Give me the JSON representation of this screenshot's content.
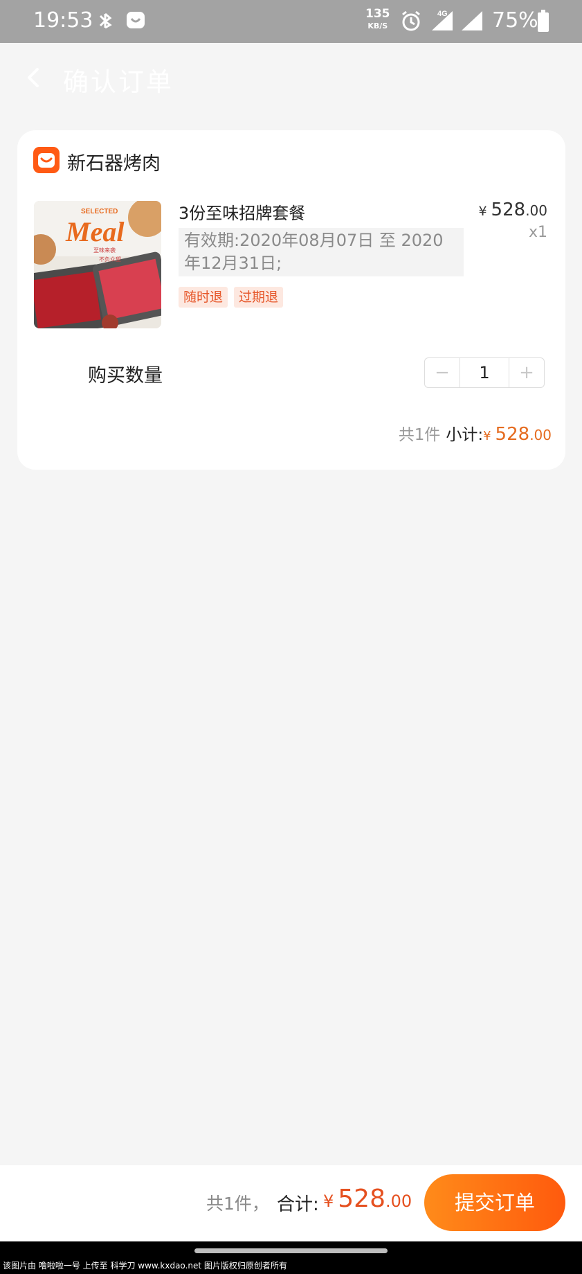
{
  "status_bar": {
    "time": "19:53",
    "net_speed_value": "135",
    "net_speed_unit": "KB/S",
    "network": "4G",
    "battery": "75%"
  },
  "header": {
    "title": "确认订单",
    "back_icon": "chevron-left-icon"
  },
  "shop": {
    "name": "新石器烤肉",
    "logo_icon": "shop-smile-icon",
    "logo_color": "#ff5a14"
  },
  "product": {
    "image_text": "SELECTED",
    "image_brand": "Meal",
    "image_sub1": "至味来袭",
    "image_sub2": "不负众望",
    "title": "3份至味招牌套餐",
    "validity": "有效期:2020年08月07日 至 2020年12月31日;",
    "tags": [
      "随时退",
      "过期退"
    ],
    "price_symbol": "¥",
    "price_int": "528",
    "price_dec": ".00",
    "qty_text": "x1"
  },
  "quantity": {
    "label": "购买数量",
    "value": "1",
    "minus": "−",
    "plus": "+"
  },
  "subtotal": {
    "count_text": "共1件",
    "label": "小计:",
    "symbol": "¥",
    "int": "528",
    "dec": ".00"
  },
  "bottom_bar": {
    "count_text": "共1件，",
    "label": "合计:",
    "symbol": "¥",
    "int": "528",
    "dec": ".00",
    "submit_label": "提交订单",
    "accent_color": "#ff5a0d"
  },
  "watermark": "该图片由 噜啦啦一号 上传至 科学刀 www.kxdao.net 图片版权归原创者所有"
}
